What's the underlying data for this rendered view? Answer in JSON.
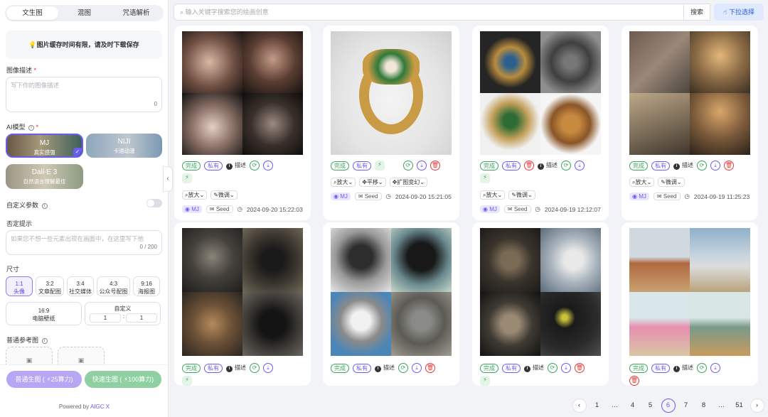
{
  "tabs": [
    "文生图",
    "混图",
    "咒语解析"
  ],
  "notice": "💡图片缓存时间有限，请及时下载保存",
  "desc_label": "图像描述",
  "desc_placeholder": "写下你的图像描述",
  "desc_count": "0",
  "model_label": "AI模型",
  "models": [
    {
      "name": "MJ",
      "sub": "真实感强"
    },
    {
      "name": "NIJI",
      "sub": "卡通动漫"
    },
    {
      "name": "Dall-E 3",
      "sub": "自然语言理解最佳"
    }
  ],
  "custom_params_label": "自定义参数",
  "neg_label": "否定提示",
  "neg_placeholder": "如果您不想一些元素出现在画面中，在这里写下他",
  "neg_count": "0 / 200",
  "size_label": "尺寸",
  "sizes": [
    {
      "ratio": "1:1",
      "name": "头像"
    },
    {
      "ratio": "3:2",
      "name": "文章配图"
    },
    {
      "ratio": "3:4",
      "name": "社交媒体"
    },
    {
      "ratio": "4:3",
      "name": "公众号配图"
    },
    {
      "ratio": "9:16",
      "name": "海报图"
    },
    {
      "ratio": "16:9",
      "name": "电脑壁纸"
    }
  ],
  "custom_size": {
    "label": "自定义",
    "w": "1",
    "sep": ":",
    "h": "1"
  },
  "ref_label": "普通参考图",
  "gen_normal": "普通生图 ( ⚡25算力)",
  "gen_fast": "快速生图 ( ⚡100算力)",
  "powered_prefix": "Powered by ",
  "powered_brand": "AIGC X",
  "search_placeholder": "输入关键字搜索您的绘画创意",
  "search_btn": "搜索",
  "dropdown_btn": "下拉选择",
  "labels": {
    "done": "完成",
    "private": "私有",
    "describe": "描述",
    "zoom": "放大",
    "pan": "平移",
    "fine": "微调",
    "expand": "扩图变幻",
    "mj": "MJ",
    "seed": "Seed"
  },
  "cards": [
    {
      "date": "2024-09-20 15:22:03"
    },
    {
      "date": "2024-09-20 15:21:05"
    },
    {
      "date": "2024-09-19 12:12:07"
    },
    {
      "date": "2024-09-19 11:25:23"
    }
  ],
  "pager": [
    "1",
    "…",
    "4",
    "5",
    "6",
    "7",
    "8",
    "…",
    "51"
  ],
  "colors": {
    "accent": "#6b5cf0",
    "green": "#3aa55d",
    "red": "#e23c3c"
  }
}
